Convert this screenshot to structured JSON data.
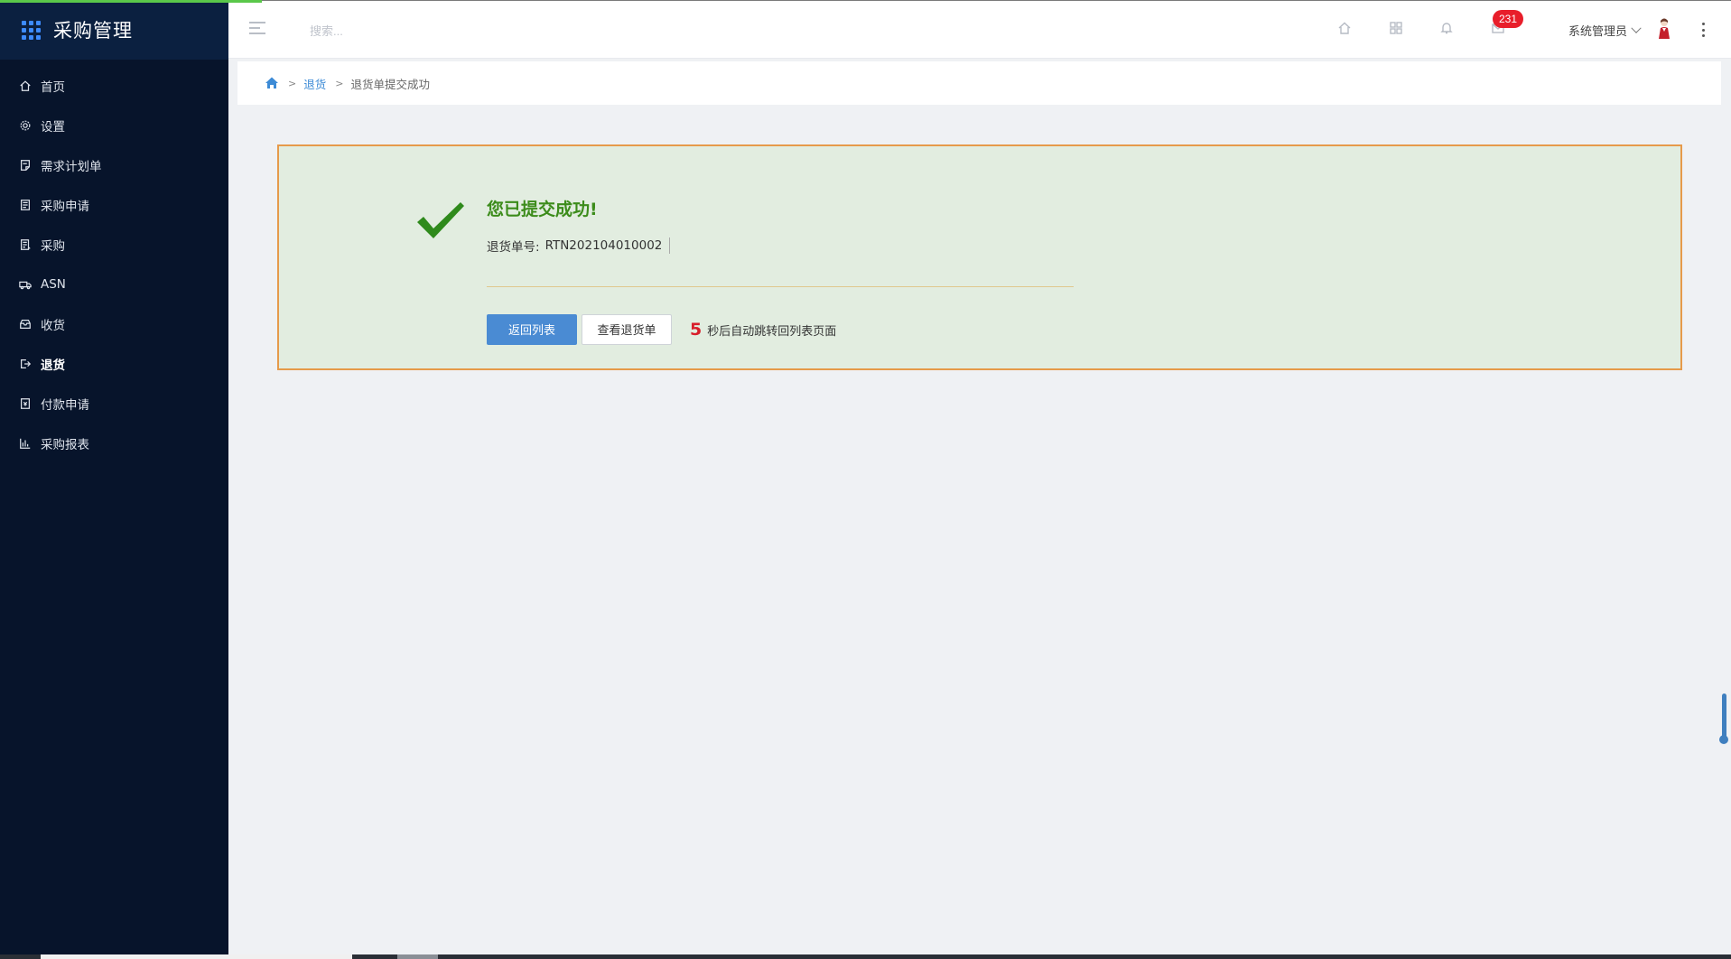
{
  "app": {
    "title": "采购管理"
  },
  "sidebar": {
    "items": [
      {
        "label": "首页",
        "icon": "home-icon",
        "active": false
      },
      {
        "label": "设置",
        "icon": "gear-icon",
        "active": false
      },
      {
        "label": "需求计划单",
        "icon": "note-icon",
        "active": false
      },
      {
        "label": "采购申请",
        "icon": "document-icon",
        "active": false
      },
      {
        "label": "采购",
        "icon": "list-icon",
        "active": false
      },
      {
        "label": "ASN",
        "icon": "truck-icon",
        "active": false
      },
      {
        "label": "收货",
        "icon": "inbox-icon",
        "active": false
      },
      {
        "label": "退货",
        "icon": "exit-icon",
        "active": true
      },
      {
        "label": "付款申请",
        "icon": "payment-icon",
        "active": false
      },
      {
        "label": "采购报表",
        "icon": "bar-chart-icon",
        "active": false
      }
    ]
  },
  "header": {
    "search_placeholder": "搜索...",
    "message_count": "231",
    "user_name": "系统管理员"
  },
  "breadcrumb": {
    "parent": "退货",
    "current": "退货单提交成功",
    "separator": ">"
  },
  "result": {
    "title": "您已提交成功!",
    "order_label": "退货单号:",
    "order_number": "RTN202104010002",
    "back_button": "返回列表",
    "view_button": "查看退货单",
    "countdown_seconds": "5",
    "countdown_text": "秒后自动跳转回列表页面"
  },
  "colors": {
    "sidebar_bg": "#07142b",
    "accent": "#4a8bd3",
    "success": "#3c8c1b",
    "panel_border": "#e69a4a",
    "badge": "#e81e2a"
  }
}
